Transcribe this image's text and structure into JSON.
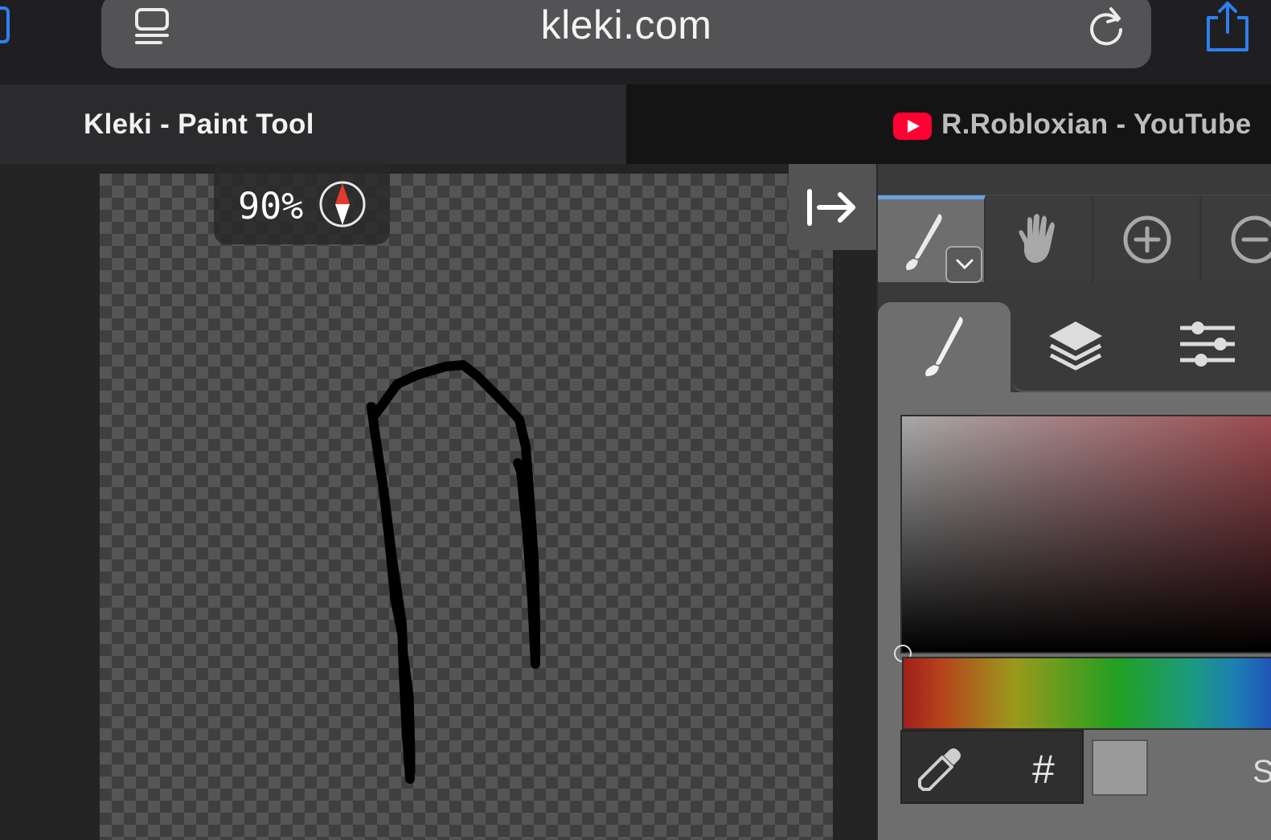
{
  "browser": {
    "url": "kleki.com",
    "tabs": [
      {
        "title": "Kleki - Paint Tool",
        "active": true
      },
      {
        "title": "R.Robloxian - YouTube",
        "active": false
      }
    ],
    "accent_color": "#2f7ff0"
  },
  "canvas": {
    "zoom": "90%",
    "stroke_color": "#000000"
  },
  "toolbar": {
    "tools": [
      "brush-icon",
      "hand-icon",
      "zoom-in-icon",
      "zoom-out-icon"
    ],
    "active_tool": "brush"
  },
  "panel_tabs": [
    "brush-icon",
    "layers-icon",
    "settings-icon"
  ],
  "color_picker": {
    "hex_label": "#",
    "current_color": "#9a9a9a",
    "truncated_text": "S"
  }
}
